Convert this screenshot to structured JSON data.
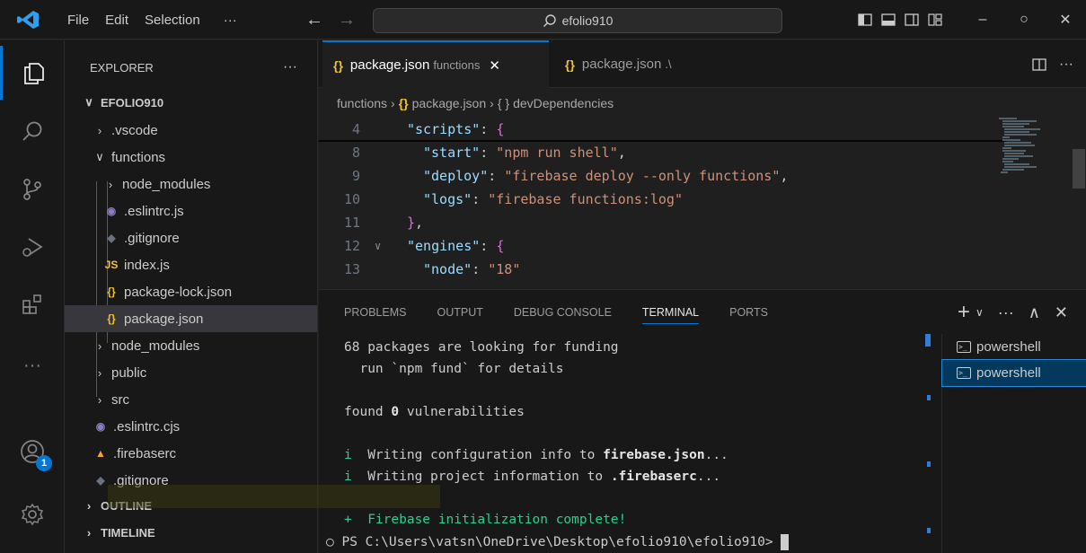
{
  "titlebar": {
    "menu": [
      "File",
      "Edit",
      "Selection",
      "···"
    ],
    "search_text": "efolio910",
    "window_buttons": [
      "–",
      "○",
      "✕"
    ]
  },
  "activity_bar": {
    "items": [
      "files-icon",
      "search-icon",
      "source-control-icon",
      "run-debug-icon",
      "extensions-icon",
      "more-icon",
      "account-icon",
      "settings-icon"
    ],
    "account_badge": "1"
  },
  "sidebar": {
    "title": "EXPLORER",
    "more": "···",
    "tree": [
      {
        "label": "EFOLIO910",
        "chevron": "∨",
        "icon": "",
        "bold": true
      },
      {
        "label": ".vscode",
        "chevron": "›",
        "icon": ""
      },
      {
        "label": "functions",
        "chevron": "∨",
        "icon": ""
      },
      {
        "label": "node_modules",
        "chevron": "›",
        "icon": ""
      },
      {
        "label": ".eslintrc.js",
        "chevron": "",
        "icon": "eslint"
      },
      {
        "label": ".gitignore",
        "chevron": "",
        "icon": "git"
      },
      {
        "label": "index.js",
        "chevron": "",
        "icon": "js"
      },
      {
        "label": "package-lock.json",
        "chevron": "",
        "icon": "json"
      },
      {
        "label": "package.json",
        "chevron": "",
        "icon": "json",
        "selected": true
      },
      {
        "label": "node_modules",
        "chevron": "›",
        "icon": ""
      },
      {
        "label": "public",
        "chevron": "›",
        "icon": ""
      },
      {
        "label": "src",
        "chevron": "›",
        "icon": ""
      },
      {
        "label": ".eslintrc.cjs",
        "chevron": "",
        "icon": "eslint"
      },
      {
        "label": ".firebaserc",
        "chevron": "",
        "icon": "firebase"
      },
      {
        "label": ".gitignore",
        "chevron": "",
        "icon": "git"
      },
      {
        "label": "OUTLINE",
        "chevron": "›",
        "icon": "",
        "bold": true
      },
      {
        "label": "TIMELINE",
        "chevron": "›",
        "icon": "",
        "bold": true
      }
    ],
    "icon_glyphs": {
      "js": "JS",
      "json": "{}",
      "git": "◆",
      "eslint": "◉",
      "firebase": "▲"
    }
  },
  "tabs": [
    {
      "label": "package.json",
      "desc": "functions",
      "close": "✕",
      "active": true
    },
    {
      "label": "package.json",
      "desc": ".\\",
      "close": "",
      "active": false
    }
  ],
  "breadcrumbs": [
    "functions",
    "›",
    "{}",
    "package.json",
    "›",
    "{ }",
    "devDependencies"
  ],
  "code": [
    {
      "ln": "4",
      "fold": "",
      "indent": 1,
      "tokens": [
        {
          "t": "\"scripts\"",
          "c": "key"
        },
        {
          "t": ": ",
          "c": "punc"
        },
        {
          "t": "{",
          "c": "brace"
        }
      ]
    },
    {
      "ln": "8",
      "fold": "",
      "indent": 2,
      "tokens": [
        {
          "t": "\"start\"",
          "c": "key"
        },
        {
          "t": ": ",
          "c": "punc"
        },
        {
          "t": "\"npm run shell\"",
          "c": "str"
        },
        {
          "t": ",",
          "c": "punc"
        }
      ]
    },
    {
      "ln": "9",
      "fold": "",
      "indent": 2,
      "tokens": [
        {
          "t": "\"deploy\"",
          "c": "key"
        },
        {
          "t": ": ",
          "c": "punc"
        },
        {
          "t": "\"firebase deploy --only functions\"",
          "c": "str"
        },
        {
          "t": ",",
          "c": "punc"
        }
      ]
    },
    {
      "ln": "10",
      "fold": "",
      "indent": 2,
      "tokens": [
        {
          "t": "\"logs\"",
          "c": "key"
        },
        {
          "t": ": ",
          "c": "punc"
        },
        {
          "t": "\"firebase functions:log\"",
          "c": "str"
        }
      ]
    },
    {
      "ln": "11",
      "fold": "",
      "indent": 1,
      "tokens": [
        {
          "t": "}",
          "c": "brace"
        },
        {
          "t": ",",
          "c": "punc"
        }
      ]
    },
    {
      "ln": "12",
      "fold": "∨",
      "indent": 1,
      "tokens": [
        {
          "t": "\"engines\"",
          "c": "key"
        },
        {
          "t": ": ",
          "c": "punc"
        },
        {
          "t": "{",
          "c": "brace"
        }
      ]
    },
    {
      "ln": "13",
      "fold": "",
      "indent": 2,
      "tokens": [
        {
          "t": "\"node\"",
          "c": "key"
        },
        {
          "t": ": ",
          "c": "punc"
        },
        {
          "t": "\"18\"",
          "c": "str"
        }
      ]
    }
  ],
  "panel": {
    "tabs": [
      "PROBLEMS",
      "OUTPUT",
      "DEBUG CONSOLE",
      "TERMINAL",
      "PORTS"
    ],
    "active_tab": "TERMINAL",
    "actions": [
      "+",
      "∨",
      "···",
      "∧",
      "✕"
    ],
    "terminal_lines": [
      [
        {
          "t": "68 packages are looking for funding",
          "c": ""
        }
      ],
      [
        {
          "t": "  run `npm fund` for details",
          "c": ""
        }
      ],
      [
        {
          "t": "",
          "c": ""
        }
      ],
      [
        {
          "t": "found ",
          "c": ""
        },
        {
          "t": "0",
          "c": "tgreen tbold"
        },
        {
          "t": " vulnerabilities",
          "c": ""
        }
      ],
      [
        {
          "t": "",
          "c": ""
        }
      ],
      [
        {
          "t": "i",
          "c": "tgreen"
        },
        {
          "t": "  Writing configuration info to ",
          "c": ""
        },
        {
          "t": "firebase.json",
          "c": "tbold"
        },
        {
          "t": "...",
          "c": ""
        }
      ],
      [
        {
          "t": "i",
          "c": "tgreen"
        },
        {
          "t": "  Writing project information to ",
          "c": ""
        },
        {
          "t": ".firebaserc",
          "c": "tbold"
        },
        {
          "t": "...",
          "c": ""
        }
      ],
      [
        {
          "t": "",
          "c": ""
        }
      ],
      [
        {
          "t": "+  Firebase initialization complete!",
          "c": "tgreen"
        }
      ],
      [
        {
          "t": "○ PS C:\\Users\\vatsn\\OneDrive\\Desktop\\efolio910\\efolio910> ",
          "c": ""
        },
        {
          "t": "",
          "c": "cursor"
        }
      ]
    ],
    "terminals": [
      {
        "label": "powershell",
        "selected": false
      },
      {
        "label": "powershell",
        "selected": true
      }
    ]
  },
  "colors": {
    "accent": "#0078d4",
    "json_icon": "#f1c232",
    "js_icon": "#f1c232"
  }
}
